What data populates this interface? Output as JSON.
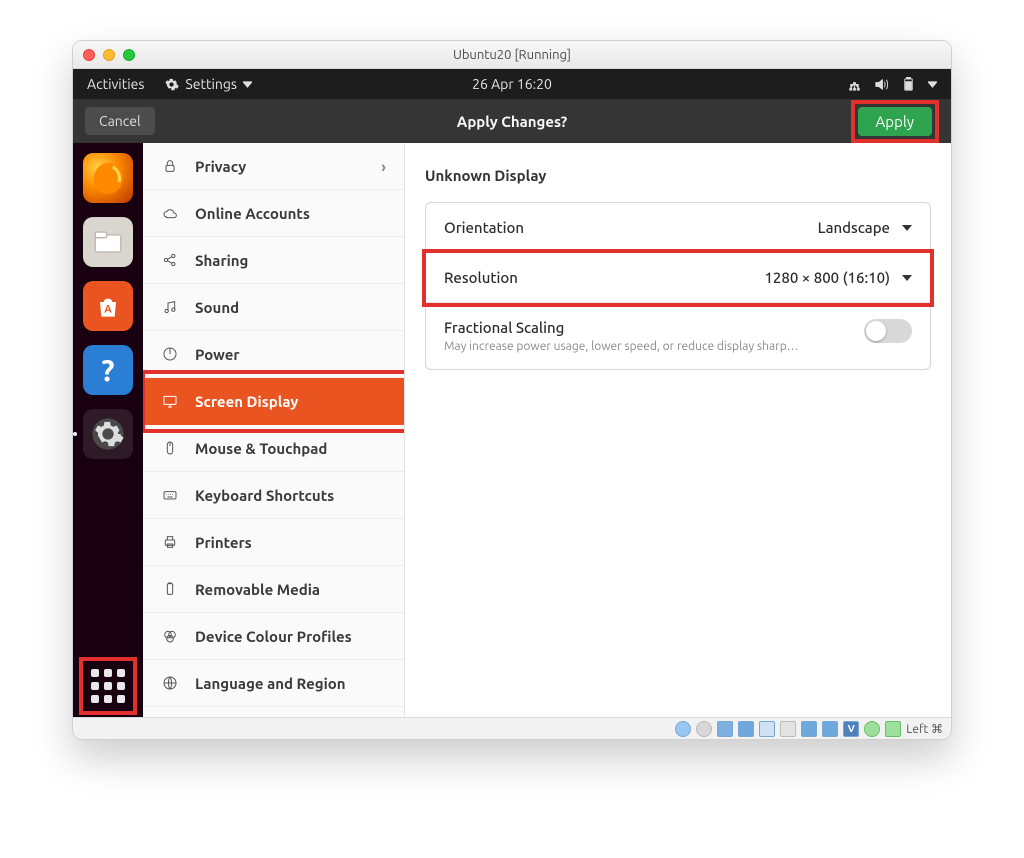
{
  "window_title": "Ubuntu20 [Running]",
  "topbar": {
    "activities": "Activities",
    "app": "Settings",
    "clock": "26 Apr  16:20"
  },
  "headerbar": {
    "cancel": "Cancel",
    "title": "Apply Changes?",
    "apply": "Apply"
  },
  "sidebar": {
    "items": [
      {
        "label": "Privacy",
        "icon": "lock",
        "has_chevron": true
      },
      {
        "label": "Online Accounts",
        "icon": "cloud"
      },
      {
        "label": "Sharing",
        "icon": "share"
      },
      {
        "label": "Sound",
        "icon": "music"
      },
      {
        "label": "Power",
        "icon": "power"
      },
      {
        "label": "Screen Display",
        "icon": "display",
        "selected": true
      },
      {
        "label": "Mouse & Touchpad",
        "icon": "mouse"
      },
      {
        "label": "Keyboard Shortcuts",
        "icon": "keyboard"
      },
      {
        "label": "Printers",
        "icon": "printer"
      },
      {
        "label": "Removable Media",
        "icon": "removable"
      },
      {
        "label": "Device Colour Profiles",
        "icon": "color"
      },
      {
        "label": "Language and Region",
        "icon": "globe"
      }
    ]
  },
  "display": {
    "section_title": "Unknown Display",
    "orientation": {
      "label": "Orientation",
      "value": "Landscape"
    },
    "resolution": {
      "label": "Resolution",
      "value": "1280 × 800 (16:10)"
    },
    "fractional": {
      "label": "Fractional Scaling",
      "subtext": "May increase power usage, lower speed, or reduce display sharp…",
      "value": false
    }
  },
  "statusbar": {
    "text": "Left ⌘"
  },
  "highlight_color": "#e2302d"
}
